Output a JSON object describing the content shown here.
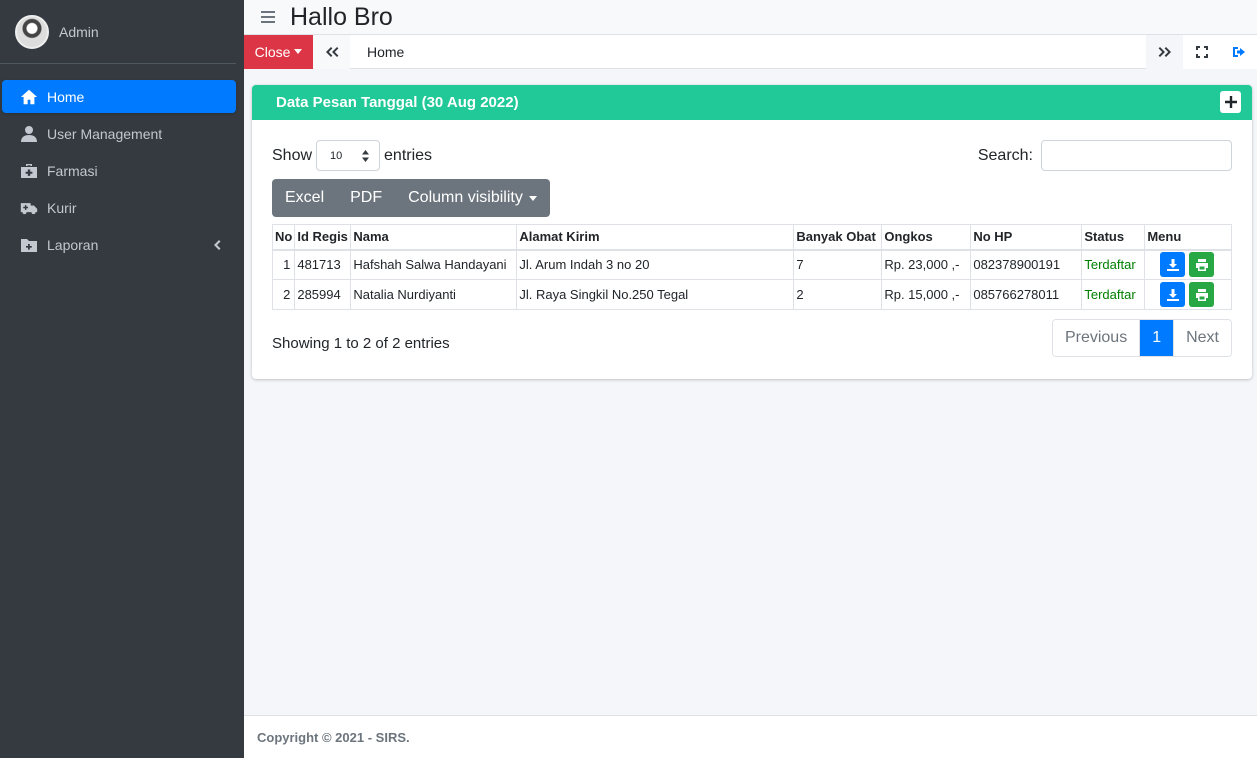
{
  "sidebar": {
    "user_name": "Admin",
    "items": [
      {
        "label": "Home",
        "icon": "home-icon",
        "active": true
      },
      {
        "label": "User Management",
        "icon": "user-icon"
      },
      {
        "label": "Farmasi",
        "icon": "medkit-icon"
      },
      {
        "label": "Kurir",
        "icon": "ambulance-icon"
      },
      {
        "label": "Laporan",
        "icon": "folder-plus-icon"
      }
    ]
  },
  "header": {
    "title": "Hallo Bro"
  },
  "tabbar": {
    "close_label": "Close",
    "home_tab": "Home"
  },
  "card": {
    "title": "Data Pesan Tanggal (30 Aug 2022)",
    "header_color": "#20c997",
    "show_label": "Show",
    "entries_value": "10",
    "entries_label": "entries",
    "search_label": "Search:",
    "search_value": "",
    "buttons": {
      "excel": "Excel",
      "pdf": "PDF",
      "colvis": "Column visibility"
    },
    "columns": [
      "No",
      "Id Regis",
      "Nama",
      "Alamat Kirim",
      "Banyak Obat",
      "Ongkos",
      "No HP",
      "Status",
      "Menu"
    ],
    "rows": [
      {
        "no": "1",
        "id": "481713",
        "nama": "Hafshah Salwa Handayani",
        "alamat": "Jl. Arum Indah 3 no 20",
        "banyak": "7",
        "ongkos": "Rp. 23,000 ,-",
        "hp": "082378900191",
        "status": "Terdaftar"
      },
      {
        "no": "2",
        "id": "285994",
        "nama": "Natalia Nurdiyanti",
        "alamat": "Jl. Raya Singkil No.250 Tegal",
        "banyak": "2",
        "ongkos": "Rp. 15,000 ,-",
        "hp": "085766278011",
        "status": "Terdaftar"
      }
    ],
    "info": "Showing 1 to 2 of 2 entries",
    "pager": {
      "prev": "Previous",
      "current": "1",
      "next": "Next"
    }
  },
  "footer": {
    "text": "Copyright © 2021 - SIRS."
  }
}
